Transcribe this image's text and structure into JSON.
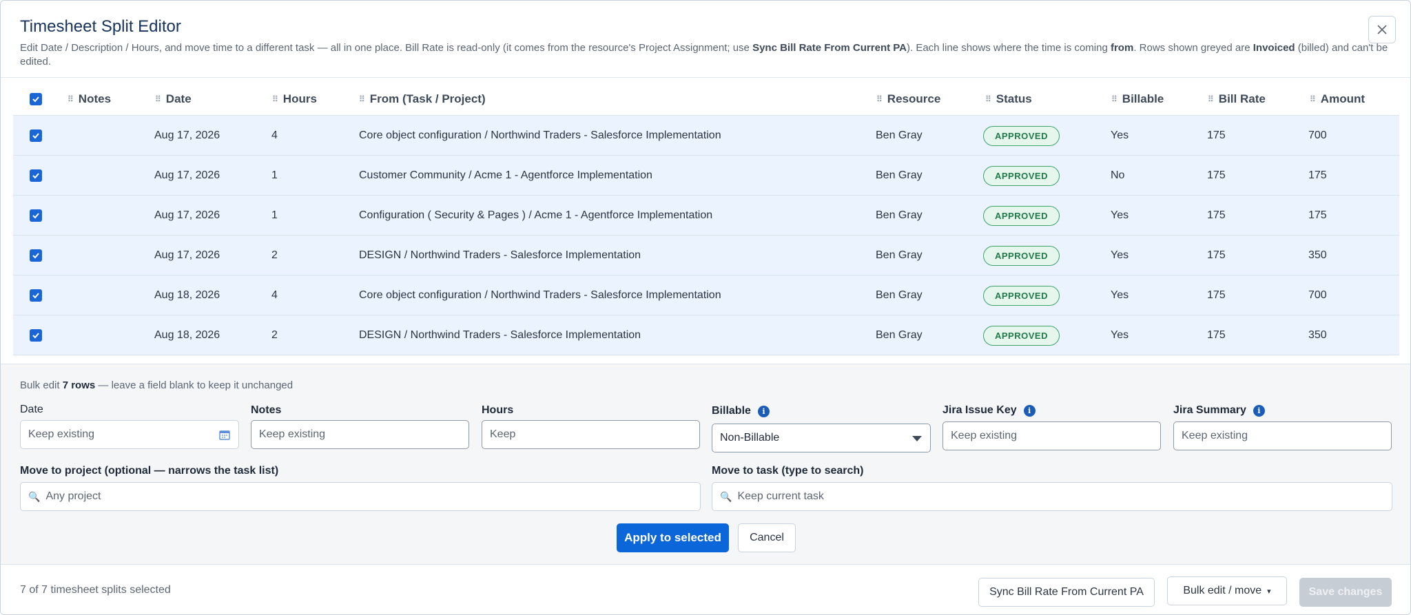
{
  "dialog": {
    "title": "Timesheet Split Editor",
    "subtitle_parts": {
      "p1": "Edit Date / Description / Hours, and move time to a different task — all in one place. Bill Rate is read-only (it comes from the resource's Project Assignment; use ",
      "b1": "Sync Bill Rate From Current PA",
      "p2": "). Each line shows where the time is coming ",
      "b2": "from",
      "p3": ". Rows shown greyed are ",
      "b3": "Invoiced",
      "p4": " (billed) and can't be edited."
    }
  },
  "table": {
    "headers": {
      "notes": "Notes",
      "date": "Date",
      "hours": "Hours",
      "from": "From (Task / Project)",
      "resource": "Resource",
      "status": "Status",
      "billable": "Billable",
      "bill_rate": "Bill Rate",
      "amount": "Amount"
    },
    "rows": [
      {
        "date": "Aug 17, 2026",
        "hours": "4",
        "from": "Core object configuration / Northwind Traders - Salesforce Implementation",
        "resource": "Ben Gray",
        "status": "APPROVED",
        "billable": "Yes",
        "bill_rate": "175",
        "amount": "700"
      },
      {
        "date": "Aug 17, 2026",
        "hours": "1",
        "from": "Customer Community / Acme 1 - Agentforce Implementation",
        "resource": "Ben Gray",
        "status": "APPROVED",
        "billable": "No",
        "bill_rate": "175",
        "amount": "175"
      },
      {
        "date": "Aug 17, 2026",
        "hours": "1",
        "from": "Configuration ( Security & Pages ) / Acme 1 - Agentforce Implementation",
        "resource": "Ben Gray",
        "status": "APPROVED",
        "billable": "Yes",
        "bill_rate": "175",
        "amount": "175"
      },
      {
        "date": "Aug 17, 2026",
        "hours": "2",
        "from": "DESIGN / Northwind Traders - Salesforce Implementation",
        "resource": "Ben Gray",
        "status": "APPROVED",
        "billable": "Yes",
        "bill_rate": "175",
        "amount": "350"
      },
      {
        "date": "Aug 18, 2026",
        "hours": "4",
        "from": "Core object configuration / Northwind Traders - Salesforce Implementation",
        "resource": "Ben Gray",
        "status": "APPROVED",
        "billable": "Yes",
        "bill_rate": "175",
        "amount": "700"
      },
      {
        "date": "Aug 18, 2026",
        "hours": "2",
        "from": "DESIGN / Northwind Traders - Salesforce Implementation",
        "resource": "Ben Gray",
        "status": "APPROVED",
        "billable": "Yes",
        "bill_rate": "175",
        "amount": "350"
      }
    ]
  },
  "bulk": {
    "title_prefix": "Bulk edit ",
    "title_count": "7 rows",
    "title_suffix": " — leave a field blank to keep it unchanged",
    "date_label": "Date",
    "date_placeholder": "Keep existing",
    "notes_label": "Notes",
    "notes_placeholder": "Keep existing",
    "hours_label": "Hours",
    "hours_placeholder": "Keep",
    "billable_label": "Billable",
    "billable_value": "Non-Billable",
    "jira_key_label": "Jira Issue Key",
    "jira_key_placeholder": "Keep existing",
    "jira_summary_label": "Jira Summary",
    "jira_summary_placeholder": "Keep existing",
    "project_label": "Move to project (optional — narrows the task list)",
    "project_placeholder": "Any project",
    "task_label": "Move to task (type to search)",
    "task_placeholder": "Keep current task",
    "apply_label": "Apply to selected",
    "cancel_label": "Cancel"
  },
  "footer": {
    "status": "7 of 7 timesheet splits selected",
    "sync_label": "Sync Bill Rate From Current PA",
    "bulk_move_label": "Bulk edit / move",
    "bulk_move_caret": "▾",
    "save_label": "Save changes"
  },
  "colors": {
    "primary": "#0b66d9",
    "row_selected": "#eaf3ff",
    "approved": "#217a49"
  }
}
